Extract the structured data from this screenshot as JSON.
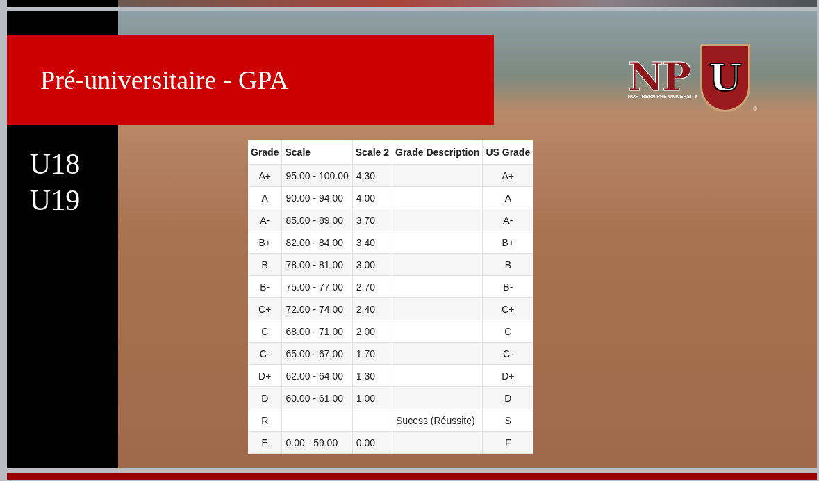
{
  "slide": {
    "title": "Pré-universitaire - GPA",
    "age_groups": [
      "U18",
      "U19"
    ],
    "logo": {
      "letters": "NP",
      "shield_letter": "U",
      "name": "NORTHERN PRE-UNIVERSITY",
      "mark": "©"
    },
    "table": {
      "columns": [
        "Grade",
        "Scale",
        "Scale 2",
        "Grade Description",
        "US Grade"
      ],
      "rows": [
        [
          "A+",
          "95.00 - 100.00",
          "4.30",
          "",
          "A+"
        ],
        [
          "A",
          "90.00 - 94.00",
          "4.00",
          "",
          "A"
        ],
        [
          "A-",
          "85.00 - 89.00",
          "3.70",
          "",
          "A-"
        ],
        [
          "B+",
          "82.00 - 84.00",
          "3.40",
          "",
          "B+"
        ],
        [
          "B",
          "78.00 - 81.00",
          "3.00",
          "",
          "B"
        ],
        [
          "B-",
          "75.00 - 77.00",
          "2.70",
          "",
          "B-"
        ],
        [
          "C+",
          "72.00 - 74.00",
          "2.40",
          "",
          "C+"
        ],
        [
          "C",
          "68.00 - 71.00",
          "2.00",
          "",
          "C"
        ],
        [
          "C-",
          "65.00 - 67.00",
          "1.70",
          "",
          "C-"
        ],
        [
          "D+",
          "62.00 - 64.00",
          "1.30",
          "",
          "D+"
        ],
        [
          "D",
          "60.00 - 61.00",
          "1.00",
          "",
          "D"
        ],
        [
          "R",
          "",
          "",
          "Sucess (Réussite)",
          "S"
        ],
        [
          "E",
          "0.00 - 59.00",
          "0.00",
          "",
          "F"
        ]
      ]
    }
  }
}
